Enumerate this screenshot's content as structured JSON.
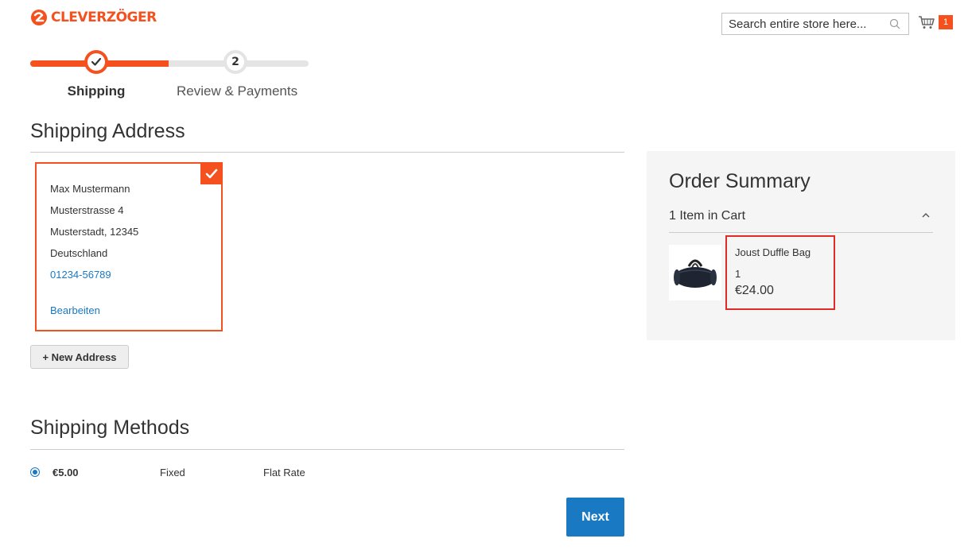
{
  "header": {
    "brand": "CLEVERZÖGER",
    "search_placeholder": "Search entire store here...",
    "cart_count": "1"
  },
  "progress": {
    "steps": [
      {
        "number": "",
        "label": "Shipping",
        "state": "complete"
      },
      {
        "number": "2",
        "label": "Review & Payments",
        "state": "pending"
      }
    ]
  },
  "shipping_address": {
    "title": "Shipping Address",
    "address": {
      "name": "Max Mustermann",
      "street": "Musterstrasse 4",
      "city_zip": "Musterstadt, 12345",
      "country": "Deutschland",
      "phone": "01234-56789",
      "edit_label": "Bearbeiten"
    },
    "new_address_label": "+ New Address"
  },
  "shipping_methods": {
    "title": "Shipping Methods",
    "methods": [
      {
        "price": "€5.00",
        "type": "Fixed",
        "carrier": "Flat Rate",
        "selected": true
      }
    ],
    "next_label": "Next"
  },
  "order_summary": {
    "title": "Order Summary",
    "items_in_cart": "1 Item in Cart",
    "items": [
      {
        "name": "Joust Duffle Bag",
        "qty": "1",
        "price": "€24.00"
      }
    ]
  },
  "colors": {
    "accent": "#f4511e",
    "link": "#1979c3",
    "highlight": "#e02b27"
  }
}
